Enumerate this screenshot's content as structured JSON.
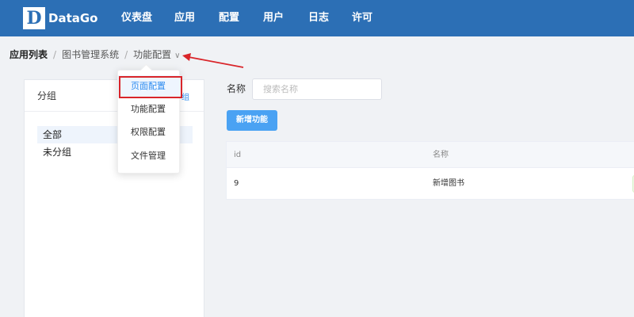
{
  "header": {
    "logo_letter": "D",
    "logo_text": "DataGo",
    "nav": [
      "仪表盘",
      "应用",
      "配置",
      "用户",
      "日志",
      "许可"
    ]
  },
  "breadcrumb": {
    "items": [
      "应用列表",
      "图书管理系统",
      "功能配置"
    ],
    "separator": "/"
  },
  "dropdown": {
    "items": [
      "页面配置",
      "功能配置",
      "权限配置",
      "文件管理"
    ],
    "highlighted_index": 0
  },
  "left_panel": {
    "title": "分组",
    "add_group_partial": "组",
    "groups": [
      "全部",
      "未分组"
    ],
    "selected_index": 0
  },
  "filter": {
    "label": "名称",
    "placeholder": "搜索名称",
    "value": ""
  },
  "actions": {
    "add_function_label": "新增功能"
  },
  "table": {
    "columns": [
      "id",
      "名称"
    ],
    "rows": [
      [
        "9",
        "新增图书"
      ]
    ]
  },
  "colors": {
    "header_bg": "#2c6fb5",
    "accent": "#2d8cf0",
    "button_bg": "#4aa2f3",
    "annotation_red": "#d9252a"
  }
}
